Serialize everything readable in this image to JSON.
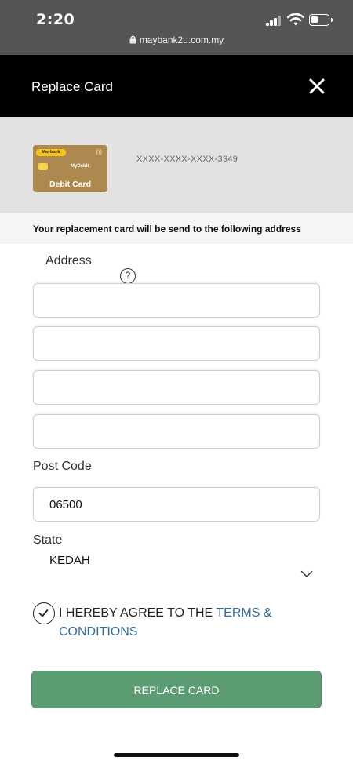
{
  "status_bar": {
    "time": "2:20",
    "url": "maybank2u.com.my",
    "icons": [
      "signal-icon",
      "wifi-icon",
      "battery-icon",
      "lock-icon"
    ]
  },
  "header": {
    "title": "Replace Card",
    "close_icon": "close-icon"
  },
  "card": {
    "bank_name": "Maybank",
    "brand": "MyDebit",
    "label": "Debit Card",
    "number": "XXXX-XXXX-XXXX-3949"
  },
  "notice": "Your replacement card will be send to the following address",
  "form": {
    "address_label": "Address",
    "help_symbol": "?",
    "address_lines": [
      "",
      "",
      "",
      ""
    ],
    "postcode_label": "Post Code",
    "postcode_value": "06500",
    "state_label": "State",
    "state_value": "KEDAH"
  },
  "agreement": {
    "text": "I HEREBY AGREE TO THE ",
    "link": "TERMS & CONDITIONS",
    "checked": true
  },
  "button": {
    "label": "REPLACE CARD"
  },
  "colors": {
    "header_bg": "#000000",
    "status_bg": "#555555",
    "button_bg": "#5c9c73",
    "link": "#2f6aa1",
    "card_gold": "#ad8950"
  }
}
